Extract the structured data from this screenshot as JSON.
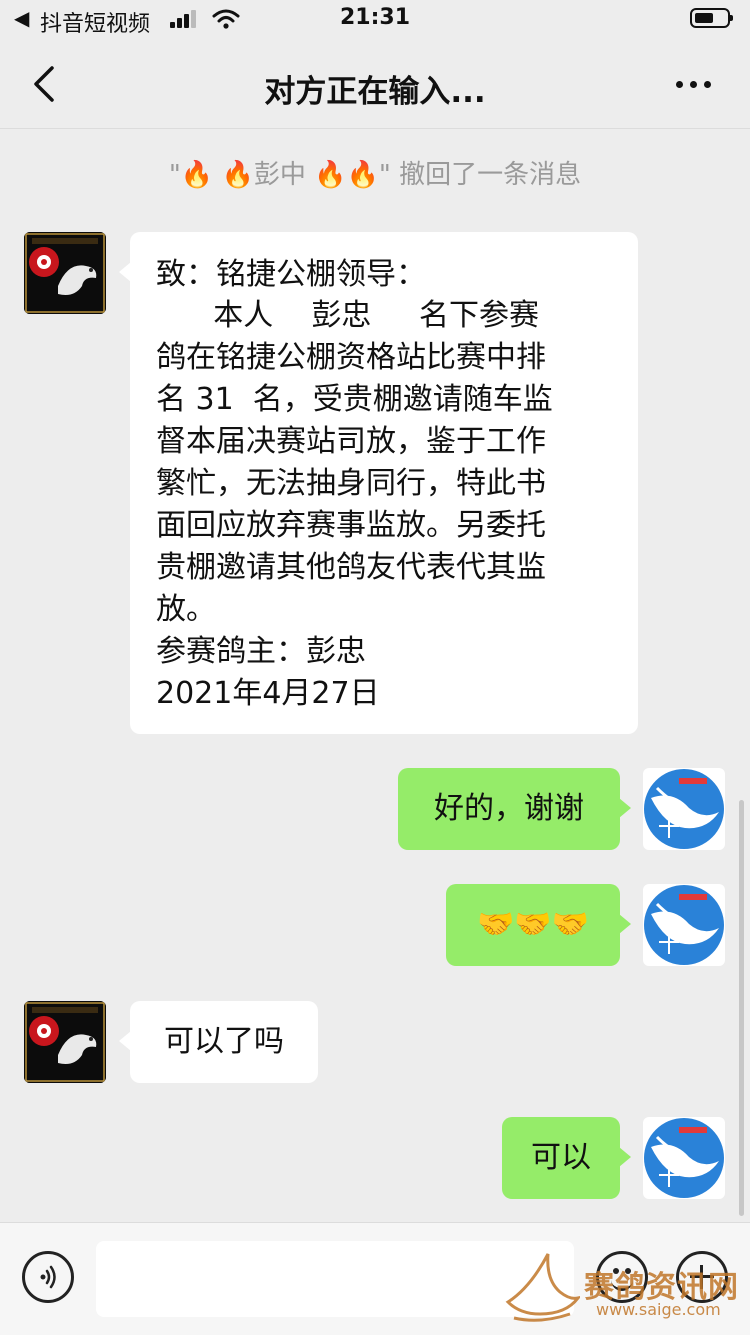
{
  "status_bar": {
    "back_glyph": "◀",
    "app_name": "抖音短视频",
    "time": "21:31"
  },
  "nav": {
    "title": "对方正在输入..."
  },
  "recall_notice": {
    "prefix": "\"🔥 🔥彭中 🔥🔥\"",
    "text": " 撤回了一条消息"
  },
  "messages": [
    {
      "side": "left",
      "lines": [
        "致：铭捷公棚领导：",
        "      本人    彭忠     名下参赛",
        "鸽在铭捷公棚资格站比赛中排",
        "名 31  名，受贵棚邀请随车监",
        "督本届决赛站司放，鉴于工作",
        "繁忙，无法抽身同行，特此书",
        "面回应放弃赛事监放。另委托",
        "贵棚邀请其他鸽友代表代其监",
        "放。",
        "参赛鸽主：彭忠",
        "2021年4月27日"
      ]
    },
    {
      "side": "right",
      "text": "好的，谢谢"
    },
    {
      "side": "right",
      "text": "🤝🤝🤝"
    },
    {
      "side": "left",
      "text": "可以了吗"
    },
    {
      "side": "right",
      "text": "可以"
    }
  ],
  "avatars": {
    "left_icon": "pigeon-avatar-icon",
    "right_icon": "dove-scale-avatar-icon"
  },
  "input_bar": {
    "placeholder": "",
    "voice_icon": "voice-icon",
    "emoji_icon": "emoji-icon",
    "plus_icon": "plus-icon"
  },
  "watermark": {
    "cn": "赛鸽资讯网",
    "en": "www.saige.com"
  },
  "colors": {
    "background": "#ededed",
    "bubble_left": "#ffffff",
    "bubble_right": "#95ec69",
    "notice_text": "#9a9a9a",
    "watermark": "#c1772a"
  }
}
